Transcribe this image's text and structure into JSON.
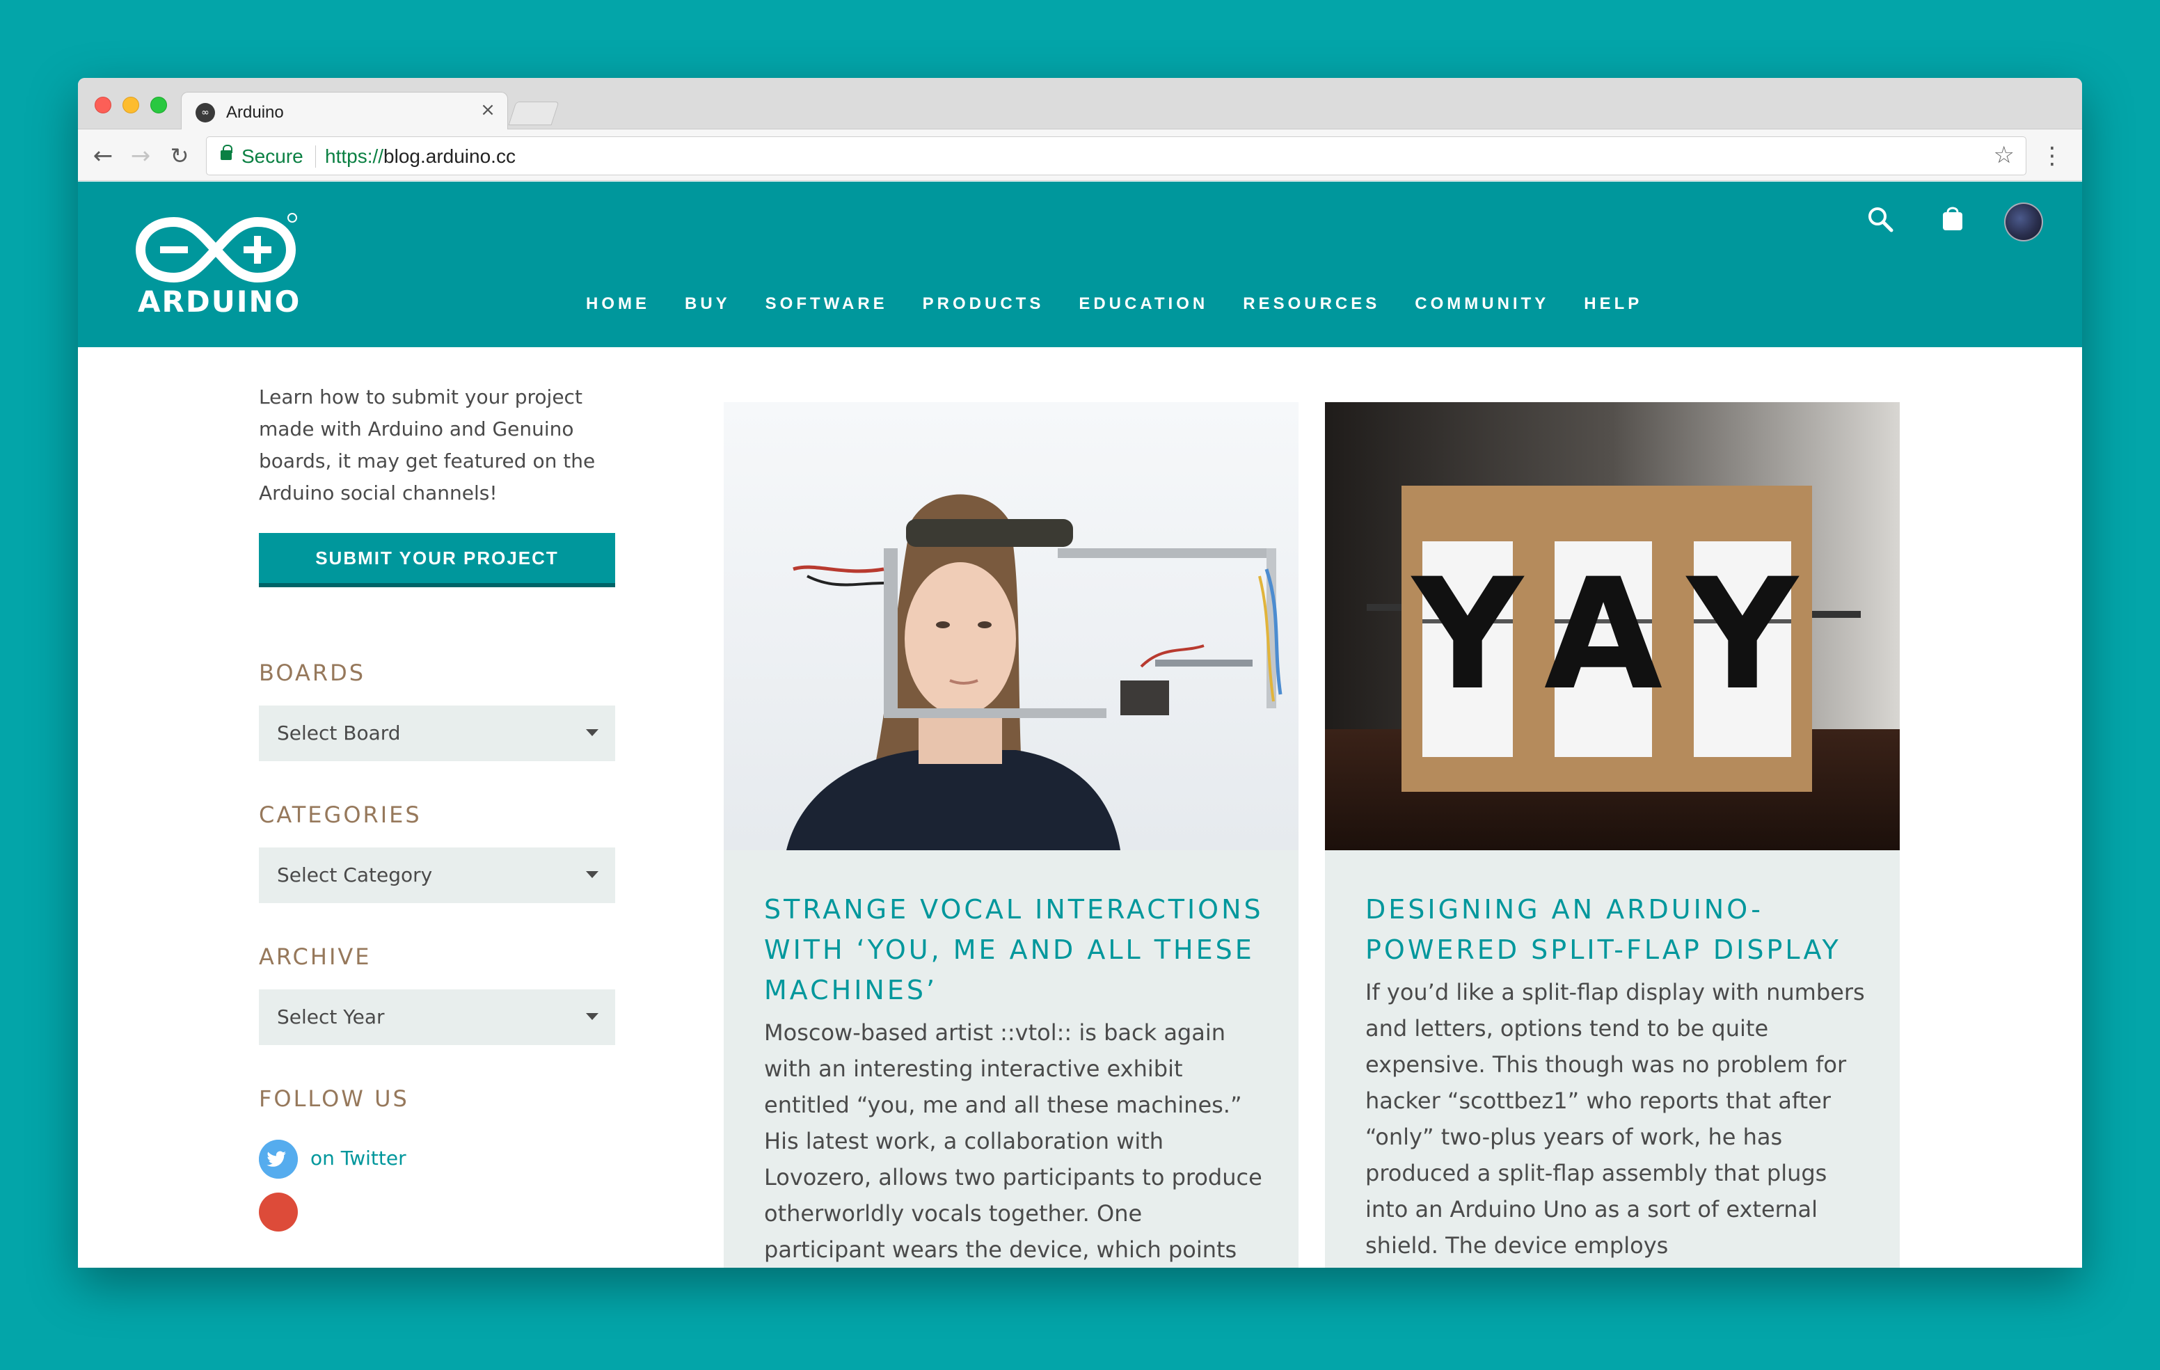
{
  "browser": {
    "tab_title": "Arduino",
    "tab_close": "×",
    "secure_label": "Secure",
    "url_scheme": "https://",
    "url_host": "blog.arduino.cc"
  },
  "header": {
    "logo_text": "ARDUINO",
    "nav": [
      "HOME",
      "BUY",
      "SOFTWARE",
      "PRODUCTS",
      "EDUCATION",
      "RESOURCES",
      "COMMUNITY",
      "HELP"
    ],
    "brand_color": "#00979c"
  },
  "sidebar": {
    "intro": "Learn how to submit your project made with Arduino and Genuino boards, it may get featured on the Arduino social channels!",
    "submit_label": "SUBMIT YOUR PROJECT",
    "boards": {
      "heading": "BOARDS",
      "select_value": "Select Board"
    },
    "categories": {
      "heading": "CATEGORIES",
      "select_value": "Select Category"
    },
    "archive": {
      "heading": "ARCHIVE",
      "select_value": "Select Year"
    },
    "follow": {
      "heading": "FOLLOW US",
      "twitter_label": "on Twitter"
    }
  },
  "posts": [
    {
      "title": "STRANGE VOCAL INTERACTIONS WITH ‘YOU, ME AND ALL THESE MACHINES’",
      "excerpt": "Moscow-based artist ::vtol:: is back again with an interesting interactive exhibit entitled “you, me and all these machines.” His latest work, a collaboration with Lovozero, allows two participants to produce otherworldly vocals together. One participant wears the device, which points"
    },
    {
      "title": "DESIGNING AN ARDUINO-POWERED SPLIT-FLAP DISPLAY",
      "excerpt": "If you’d like a split-flap display with numbers and letters, options tend to be quite expensive. This though was no problem for hacker “scottbez1” who reports that after “only” two-plus years of work, he has produced a split-flap assembly that plugs into an Arduino Uno as a sort of external shield. The device employs",
      "flap_letters": [
        "Y",
        "A",
        "Y"
      ]
    }
  ]
}
